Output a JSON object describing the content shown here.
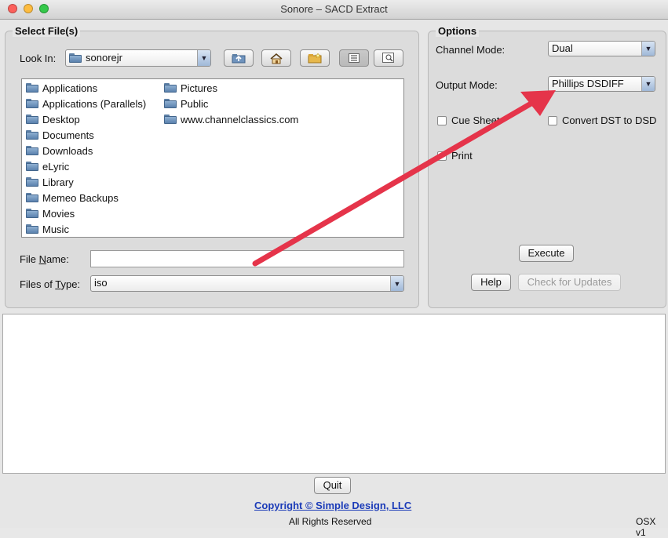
{
  "window": {
    "title": "Sonore – SACD Extract"
  },
  "select_files": {
    "group_title": "Select File(s)",
    "look_in_label": "Look In:",
    "look_in_value": "sonorejr",
    "toolbar_icons": [
      "up-folder-icon",
      "home-icon",
      "new-folder-icon",
      "list-view-icon",
      "details-view-icon"
    ],
    "files_col1": [
      "Applications",
      "Applications (Parallels)",
      "Desktop",
      "Documents",
      "Downloads",
      "eLyric",
      "Library",
      "Memeo Backups",
      "Movies",
      "Music"
    ],
    "files_col2": [
      "Pictures",
      "Public",
      "www.channelclassics.com"
    ],
    "file_name_label": "File Name:",
    "file_name_value": "",
    "files_of_type_label": "Files of Type:",
    "files_of_type_value": "iso"
  },
  "options": {
    "group_title": "Options",
    "channel_mode_label": "Channel Mode:",
    "channel_mode_value": "Dual",
    "output_mode_label": "Output Mode:",
    "output_mode_value": "Phillips DSDIFF",
    "cue_sheet_label": "Cue Sheet",
    "convert_dst_label": "Convert DST to DSD",
    "print_label": "Print",
    "execute_label": "Execute",
    "help_label": "Help",
    "check_updates_label": "Check for Updates"
  },
  "log": {
    "text": ""
  },
  "footer": {
    "quit_label": "Quit",
    "copyright": "Copyright © Simple Design, LLC",
    "rights": "All Rights Reserved",
    "version": "OSX v1"
  },
  "annotation": {
    "arrow_color": "#e5344a"
  }
}
